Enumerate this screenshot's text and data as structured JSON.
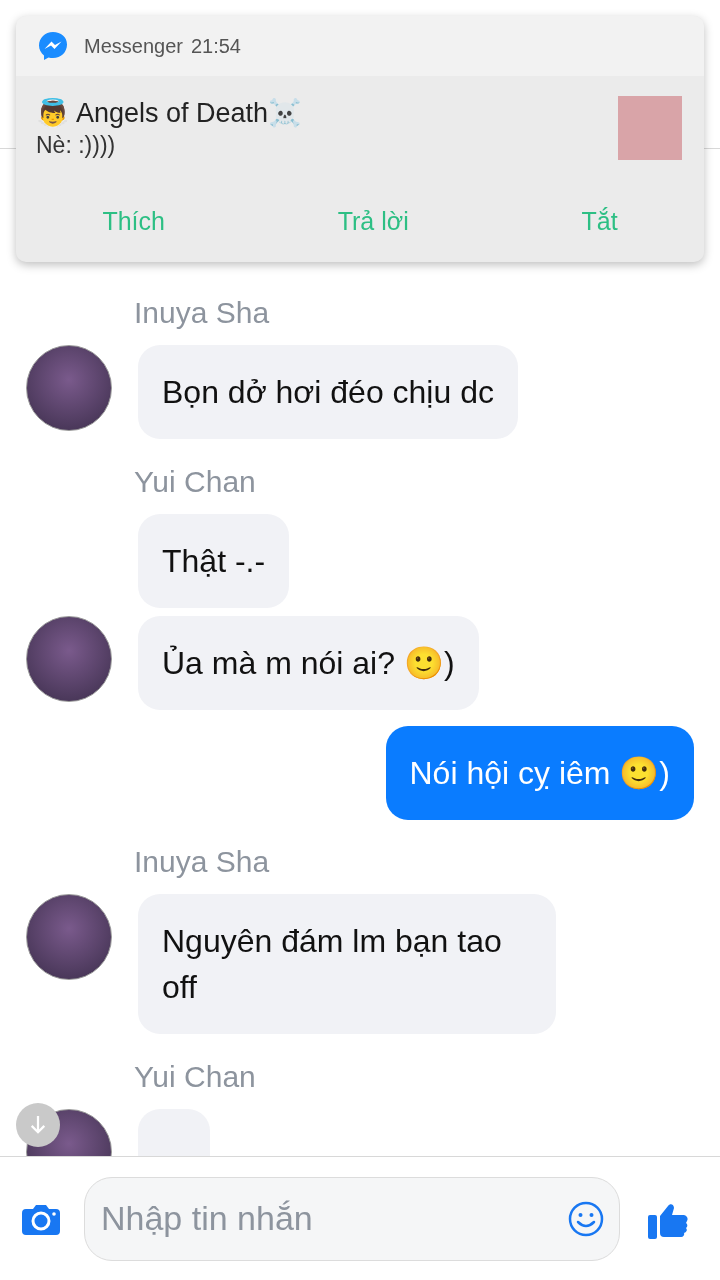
{
  "notification": {
    "app": "Messenger",
    "time": "21:54",
    "title": "👼 Angels of Death☠️",
    "text": "Nè: :))))",
    "actions": [
      "Thích",
      "Trả lời",
      "Tắt"
    ]
  },
  "messages": [
    {
      "kind": "sender",
      "text": "Inuya Sha"
    },
    {
      "kind": "incoming",
      "text": "Bọn dở hơi đéo chịu dc",
      "avatar": true
    },
    {
      "kind": "sender",
      "text": "Yui Chan"
    },
    {
      "kind": "incoming",
      "text": "Thật -.-",
      "avatar": false
    },
    {
      "kind": "incoming",
      "text": "Ủa mà m nói ai? 🙂)",
      "avatar": true
    },
    {
      "kind": "outgoing",
      "text": "Nói hội cỵ iêm 🙂)"
    },
    {
      "kind": "sender",
      "text": "Inuya Sha"
    },
    {
      "kind": "incoming",
      "text": "Nguyên đám lm bạn tao off",
      "avatar": true
    },
    {
      "kind": "sender",
      "text": "Yui Chan"
    },
    {
      "kind": "incoming",
      "avatar": true
    }
  ],
  "composer": {
    "placeholder": "Nhập tin nhắn"
  }
}
